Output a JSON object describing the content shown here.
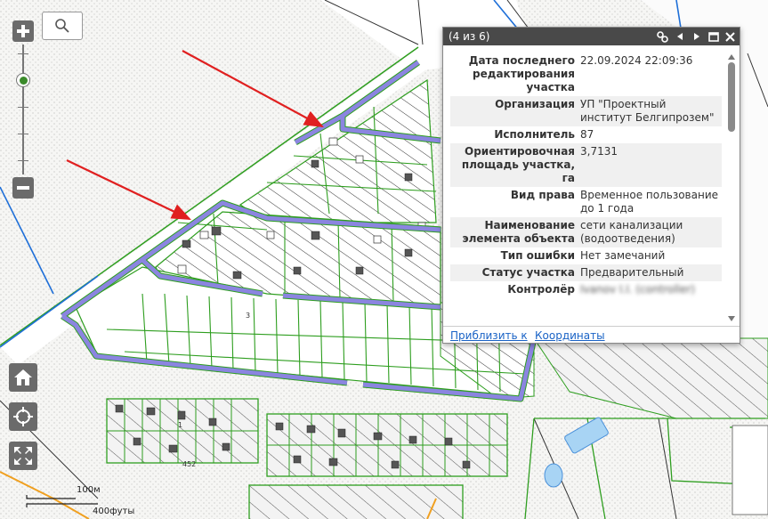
{
  "map": {
    "scale_metric": "100м",
    "scale_imperial": "400футы",
    "lot_label_1": "3",
    "lot_label_2": "452",
    "lot_label_3": "1"
  },
  "controls": {
    "zoom_in_icon": "plus-icon",
    "zoom_out_icon": "minus-icon",
    "search_icon": "magnifier-icon",
    "home_icon": "home-icon",
    "locate_icon": "crosshair-icon",
    "extent_icon": "expand-icon"
  },
  "popup": {
    "title": "(4 из 6)",
    "rows": [
      {
        "key": "Дата последнего редактирования участка",
        "value": "22.09.2024 22:09:36"
      },
      {
        "key": "Организация",
        "value": "УП \"Проектный институт Белгипрозем\""
      },
      {
        "key": "Исполнитель",
        "value": "87"
      },
      {
        "key": "Ориентировочная площадь участка, га",
        "value": "3,7131"
      },
      {
        "key": "Вид права",
        "value": "Временное пользование до 1 года"
      },
      {
        "key": "Наименование элемента объекта",
        "value": "сети канализации (водоотведения)"
      },
      {
        "key": "Тип ошибки",
        "value": "Нет замечаний"
      },
      {
        "key": "Статус участка",
        "value": "Предварительный"
      },
      {
        "key": "Контролёр",
        "value": "Ivanov I.I. (controller)"
      }
    ],
    "link_zoom": "Приблизить к",
    "link_coords": "Координаты"
  },
  "colors": {
    "parcel_green": "#2e9e1f",
    "highlight_purple": "#8b85e0",
    "arrow_red": "#e02020",
    "road_blue": "#1e6fd8",
    "popup_header": "#494949"
  }
}
